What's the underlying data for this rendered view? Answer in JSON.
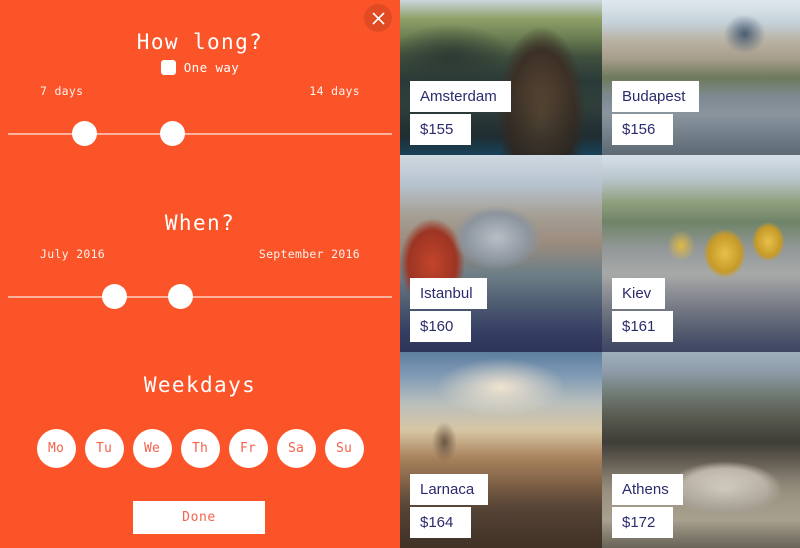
{
  "theme": {
    "accent": "#fa5428",
    "panel_bg": "#fa5428",
    "card_label_bg": "#ffffff",
    "card_text": "#2b2b6e",
    "button_text": "#f4624a"
  },
  "panel": {
    "close_icon": "close-icon",
    "duration": {
      "title": "How long?",
      "one_way_label": "One way",
      "one_way_checked": false,
      "min_label": "7 days",
      "max_label": "14 days",
      "handle_left_pct": "21",
      "handle_right_pct": "43"
    },
    "when": {
      "title": "When?",
      "min_label": "July 2016",
      "max_label": "September 2016",
      "handle_left_pct": "28.5",
      "handle_right_pct": "45"
    },
    "weekdays": {
      "title": "Weekdays",
      "days": [
        {
          "label": "Mo"
        },
        {
          "label": "Tu"
        },
        {
          "label": "We"
        },
        {
          "label": "Th"
        },
        {
          "label": "Fr"
        },
        {
          "label": "Sa"
        },
        {
          "label": "Su"
        }
      ]
    },
    "done_label": "Done"
  },
  "destinations": [
    {
      "city": "Amsterdam",
      "price": "$155"
    },
    {
      "city": "Budapest",
      "price": "$156"
    },
    {
      "city": "Istanbul",
      "price": "$160"
    },
    {
      "city": "Kiev",
      "price": "$161"
    },
    {
      "city": "Larnaca",
      "price": "$164"
    },
    {
      "city": "Athens",
      "price": "$172"
    }
  ]
}
